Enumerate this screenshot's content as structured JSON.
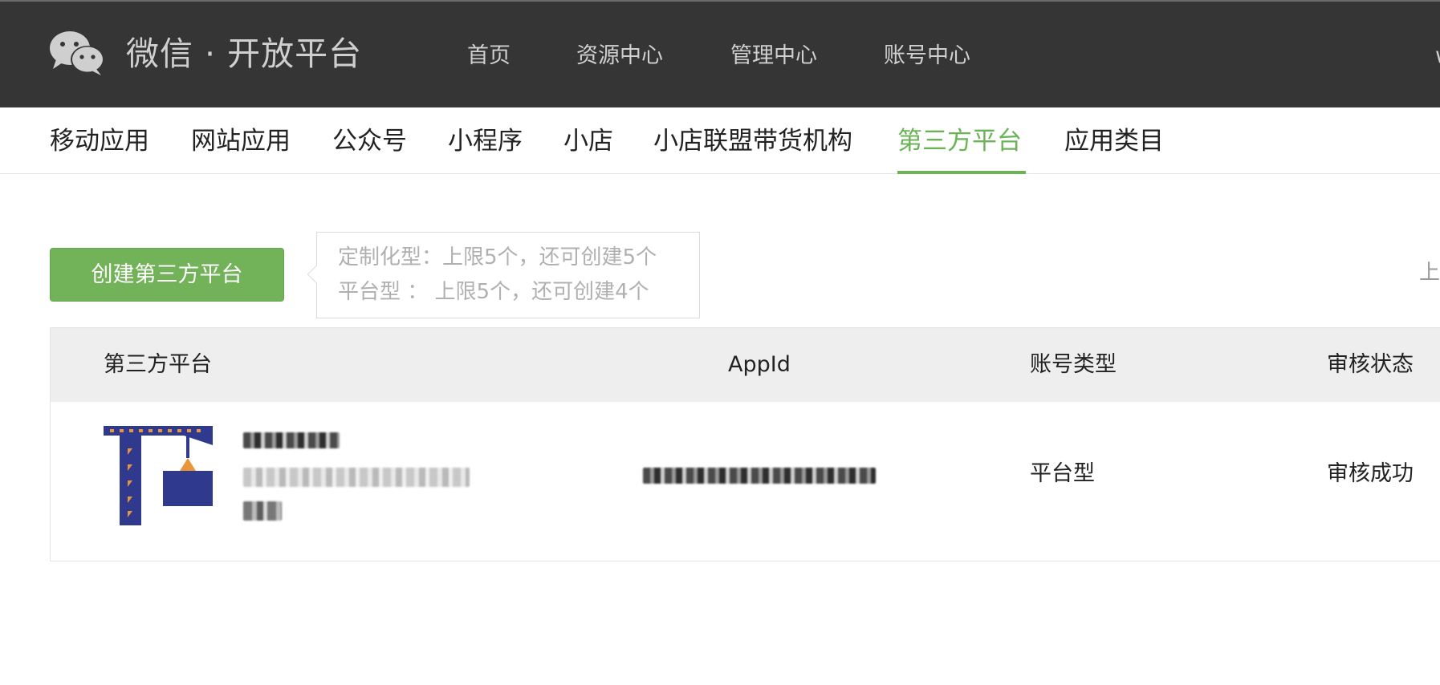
{
  "header": {
    "logo_text": "微信 · 开放平台",
    "nav": [
      "首页",
      "资源中心",
      "管理中心",
      "账号中心"
    ],
    "user_clip": "w"
  },
  "subnav": {
    "items": [
      "移动应用",
      "网站应用",
      "公众号",
      "小程序",
      "小店",
      "小店联盟带货机构",
      "第三方平台",
      "应用类目"
    ],
    "active_index": 6
  },
  "toolbar": {
    "create_label": "创建第三方平台",
    "quota_custom": "定制化型：上限5个，还可创建5个",
    "quota_platform": "平台型 ： 上限5个，还可创建4个",
    "right_clip": "上"
  },
  "table": {
    "headers": [
      "第三方平台",
      "AppId",
      "账号类型",
      "审核状态"
    ],
    "rows": [
      {
        "account_type": "平台型",
        "status": "审核成功"
      }
    ]
  },
  "colors": {
    "accent": "#6bb456",
    "header_bg": "#353535",
    "table_head_bg": "#eeeeef",
    "logo_blue": "#2f3a8f",
    "logo_orange": "#e9953a"
  }
}
